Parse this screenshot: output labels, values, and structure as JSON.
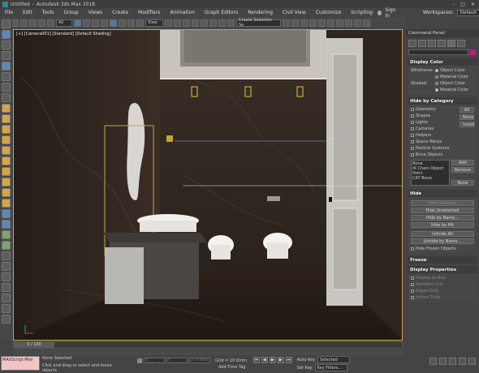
{
  "title": {
    "doc": "Untitled",
    "app": "Autodesk 3ds Max 2018"
  },
  "menu": [
    "File",
    "Edit",
    "Tools",
    "Group",
    "Views",
    "Create",
    "Modifiers",
    "Animation",
    "Graph Editors",
    "Rendering",
    "Civil View",
    "Customize",
    "Scripting"
  ],
  "signin": "Sign In",
  "workspaces_label": "Workspaces:",
  "workspace_value": "Default",
  "toolbar": {
    "view_dropdown": "View",
    "selection_set": "Create Selection Se"
  },
  "viewport": {
    "label": "[+] [Camera001] [Standard] [Default Shading]"
  },
  "command_panel": {
    "title": "Command Panel",
    "display_color": {
      "header": "Display Color",
      "wireframe_label": "Wireframe:",
      "shaded_label": "Shaded:",
      "object_color": "Object Color",
      "material_color": "Material Color"
    },
    "hide_by_category": {
      "header": "Hide by Category",
      "categories": [
        "Geometry",
        "Shapes",
        "Lights",
        "Cameras",
        "Helpers",
        "Space Warps",
        "Particle Systems",
        "Bone Objects"
      ],
      "all": "All",
      "none": "None",
      "invert": "Invert",
      "list": [
        "Bone",
        "IK Chain Object",
        "Point",
        "CAT Bone"
      ],
      "add": "Add",
      "remove": "Remove",
      "none2": "None"
    },
    "hide": {
      "header": "Hide",
      "hide_selected": "Hide Selected",
      "hide_unselected": "Hide Unselected",
      "hide_by_name": "Hide by Name...",
      "hide_by_hit": "Hide by Hit",
      "unhide_all": "Unhide All",
      "unhide_by_name": "Unhide by Name...",
      "hide_frozen": "Hide Frozen Objects"
    },
    "freeze": {
      "header": "Freeze"
    },
    "display_properties": {
      "header": "Display Properties",
      "items": [
        "Display as Box",
        "Backface Cull",
        "Edges Only",
        "Vertex Ticks"
      ]
    }
  },
  "timeline": {
    "frame": "0 / 100"
  },
  "status": {
    "maxscript": "MAXScript Mini",
    "none_selected": "None Selected",
    "hint": "Click and drag to select and move objects",
    "x": "X: 3377.95m",
    "y": "Y: 10080.85m",
    "z": "Z: 0.0mm",
    "grid": "Grid = 10.0mm",
    "add_time_tag": "Add Time Tag",
    "auto_key": "Auto Key",
    "set_key": "Set Key",
    "selected": "Selected",
    "key_filters": "Key Filters..."
  }
}
